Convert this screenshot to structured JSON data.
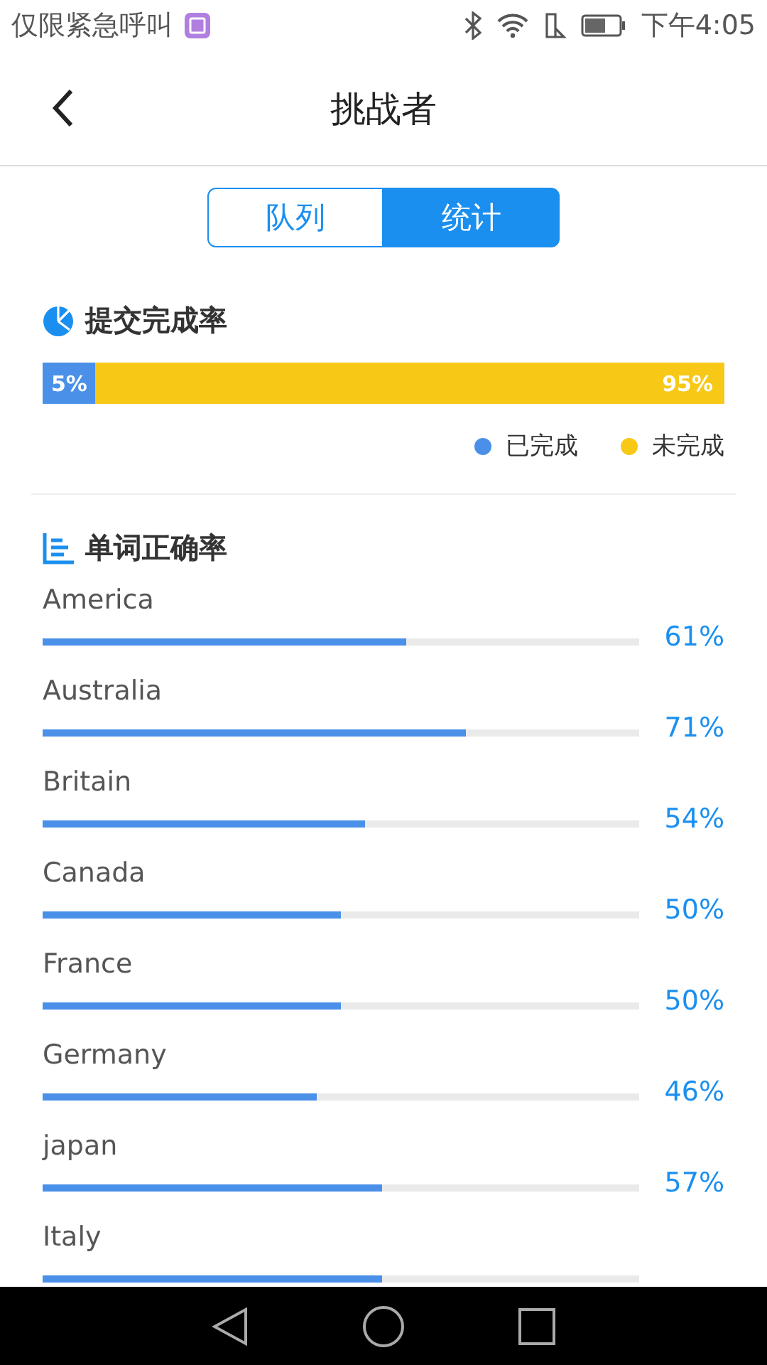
{
  "status_bar": {
    "carrier": "仅限紧急呼叫",
    "time": "下午4:05"
  },
  "header": {
    "title": "挑战者"
  },
  "tabs": [
    {
      "label": "队列",
      "selected": false
    },
    {
      "label": "统计",
      "selected": true
    }
  ],
  "submission": {
    "title": "提交完成率",
    "level": 0.05,
    "done_text": "5%",
    "undone_text": "95%",
    "legend": [
      {
        "label": "已完成",
        "color": "#4a90e8"
      },
      {
        "label": "未完成",
        "color": "#f7c815"
      }
    ]
  },
  "accuracy": {
    "title": "单词正确率",
    "rows": [
      {
        "name": "America",
        "level": 0.61,
        "reading": "61%"
      },
      {
        "name": "Australia",
        "level": 0.71,
        "reading": "71%"
      },
      {
        "name": "Britain",
        "level": 0.54,
        "reading": "54%"
      },
      {
        "name": "Canada",
        "level": 0.5,
        "reading": "50%"
      },
      {
        "name": "France",
        "level": 0.5,
        "reading": "50%"
      },
      {
        "name": "Germany",
        "level": 0.46,
        "reading": "46%"
      },
      {
        "name": "japan",
        "level": 0.57,
        "reading": "57%"
      },
      {
        "name": "Italy",
        "level": 0.57
      }
    ]
  }
}
